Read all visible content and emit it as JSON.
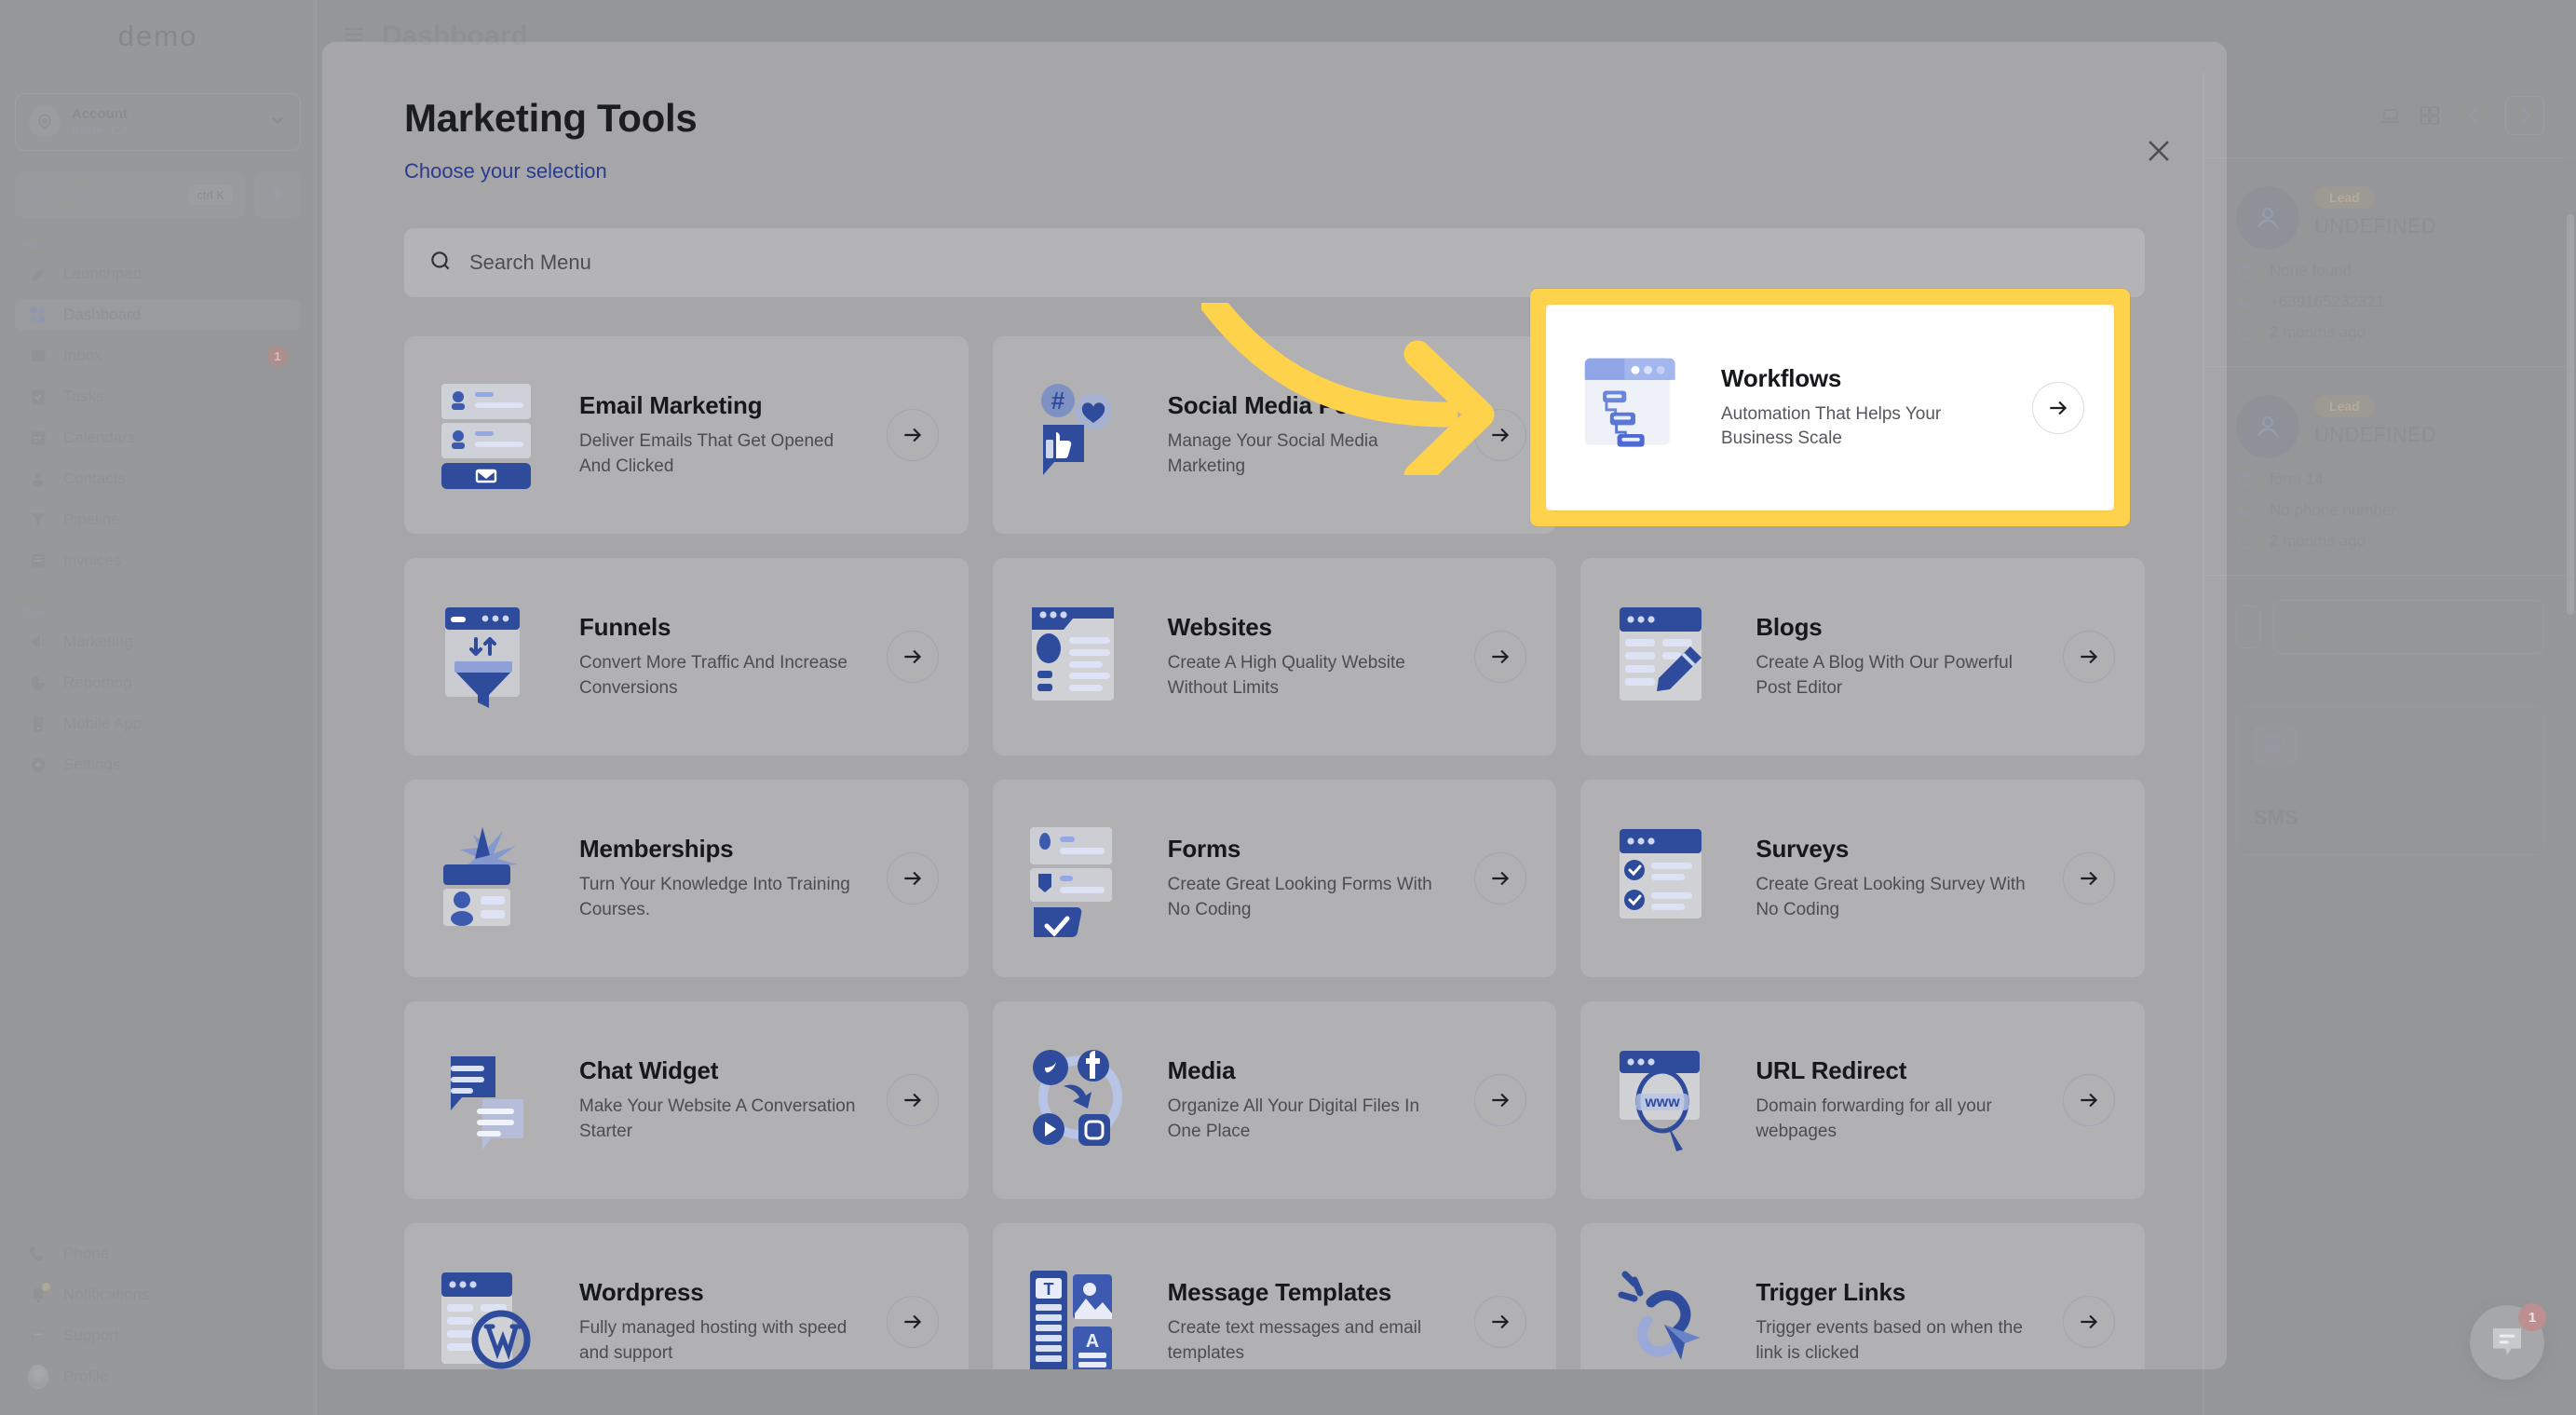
{
  "background": {
    "brand": "demo",
    "page_title": "Dashboard",
    "account": {
      "name": "Account",
      "location": "Irvine, CA"
    },
    "search": {
      "label": "Search",
      "shortcut": "ctrl K"
    },
    "nav_groups": [
      {
        "label": "Apps",
        "items": [
          {
            "label": "Launchpad",
            "icon": "launchpad-icon",
            "badge": ""
          },
          {
            "label": "Dashboard",
            "icon": "dashboard-icon",
            "badge": "",
            "active": true
          },
          {
            "label": "Inbox",
            "icon": "inbox-icon",
            "badge": "1"
          },
          {
            "label": "Tasks",
            "icon": "tasks-icon",
            "badge": ""
          },
          {
            "label": "Calendars",
            "icon": "calendar-icon",
            "badge": ""
          },
          {
            "label": "Contacts",
            "icon": "contacts-icon",
            "badge": ""
          },
          {
            "label": "Pipeline",
            "icon": "pipeline-icon",
            "badge": ""
          },
          {
            "label": "Invoices",
            "icon": "invoices-icon",
            "badge": ""
          }
        ]
      },
      {
        "label": "Tools",
        "items": [
          {
            "label": "Marketing",
            "icon": "megaphone-icon",
            "badge": ""
          },
          {
            "label": "Reporting",
            "icon": "pie-chart-icon",
            "badge": ""
          },
          {
            "label": "Mobile App",
            "icon": "mobile-icon",
            "badge": ""
          },
          {
            "label": "Settings",
            "icon": "gear-icon",
            "badge": ""
          }
        ]
      }
    ],
    "nav_bottom": [
      {
        "label": "Phone",
        "icon": "phone-icon"
      },
      {
        "label": "Notifications",
        "icon": "bell-icon"
      },
      {
        "label": "Support",
        "icon": "support-chat-icon"
      },
      {
        "label": "Profile",
        "icon": "avatar-icon"
      }
    ],
    "leads": [
      {
        "tag": "Lead",
        "name": "UNDEFINED",
        "source": "None found",
        "phone": "+639165232321",
        "time": "2 months ago"
      },
      {
        "tag": "Lead",
        "name": "UNDEFINED",
        "source": "form 14",
        "phone": "No phone number",
        "time": "2 months ago"
      }
    ],
    "assignee_placeholder": "Select Assignee",
    "sms_label": "SMS",
    "chat_badge": "1"
  },
  "modal": {
    "title": "Marketing Tools",
    "subtitle": "Choose your selection",
    "search_placeholder": "Search Menu",
    "close_label": "×",
    "cards": [
      {
        "title": "Email Marketing",
        "desc": "Deliver Emails That Get Opened And Clicked",
        "art": "email-marketing-art"
      },
      {
        "title": "Social Media Posting",
        "desc": "Manage Your Social Media Marketing",
        "art": "social-media-art"
      },
      {
        "title": "Workflows",
        "desc": "Automation That Helps Your Business Scale",
        "art": "workflows-art",
        "highlighted": true
      },
      {
        "title": "Funnels",
        "desc": "Convert More Traffic And Increase Conversions",
        "art": "funnels-art"
      },
      {
        "title": "Websites",
        "desc": "Create A High Quality Website Without Limits",
        "art": "websites-art"
      },
      {
        "title": "Blogs",
        "desc": "Create A Blog With Our Powerful Post Editor",
        "art": "blogs-art"
      },
      {
        "title": "Memberships",
        "desc": "Turn Your Knowledge Into Training Courses.",
        "art": "memberships-art"
      },
      {
        "title": "Forms",
        "desc": "Create Great Looking Forms With No Coding",
        "art": "forms-art"
      },
      {
        "title": "Surveys",
        "desc": "Create Great Looking Survey With No Coding",
        "art": "surveys-art"
      },
      {
        "title": "Chat Widget",
        "desc": "Make Your Website A Conversation Starter",
        "art": "chat-widget-art"
      },
      {
        "title": "Media",
        "desc": "Organize All Your Digital Files In One Place",
        "art": "media-art"
      },
      {
        "title": "URL Redirect",
        "desc": "Domain forwarding for all your webpages",
        "art": "url-redirect-art"
      },
      {
        "title": "Wordpress",
        "desc": "Fully managed hosting with speed and support",
        "art": "wordpress-art"
      },
      {
        "title": "Message Templates",
        "desc": "Create text messages and email templates",
        "art": "message-templates-art"
      },
      {
        "title": "Trigger Links",
        "desc": "Trigger events based on when the link is clicked",
        "art": "trigger-links-art"
      }
    ]
  },
  "annotation": {
    "highlight_color": "#FFD24C",
    "arrow_color": "#FFD24C",
    "target_card": "Workflows"
  }
}
